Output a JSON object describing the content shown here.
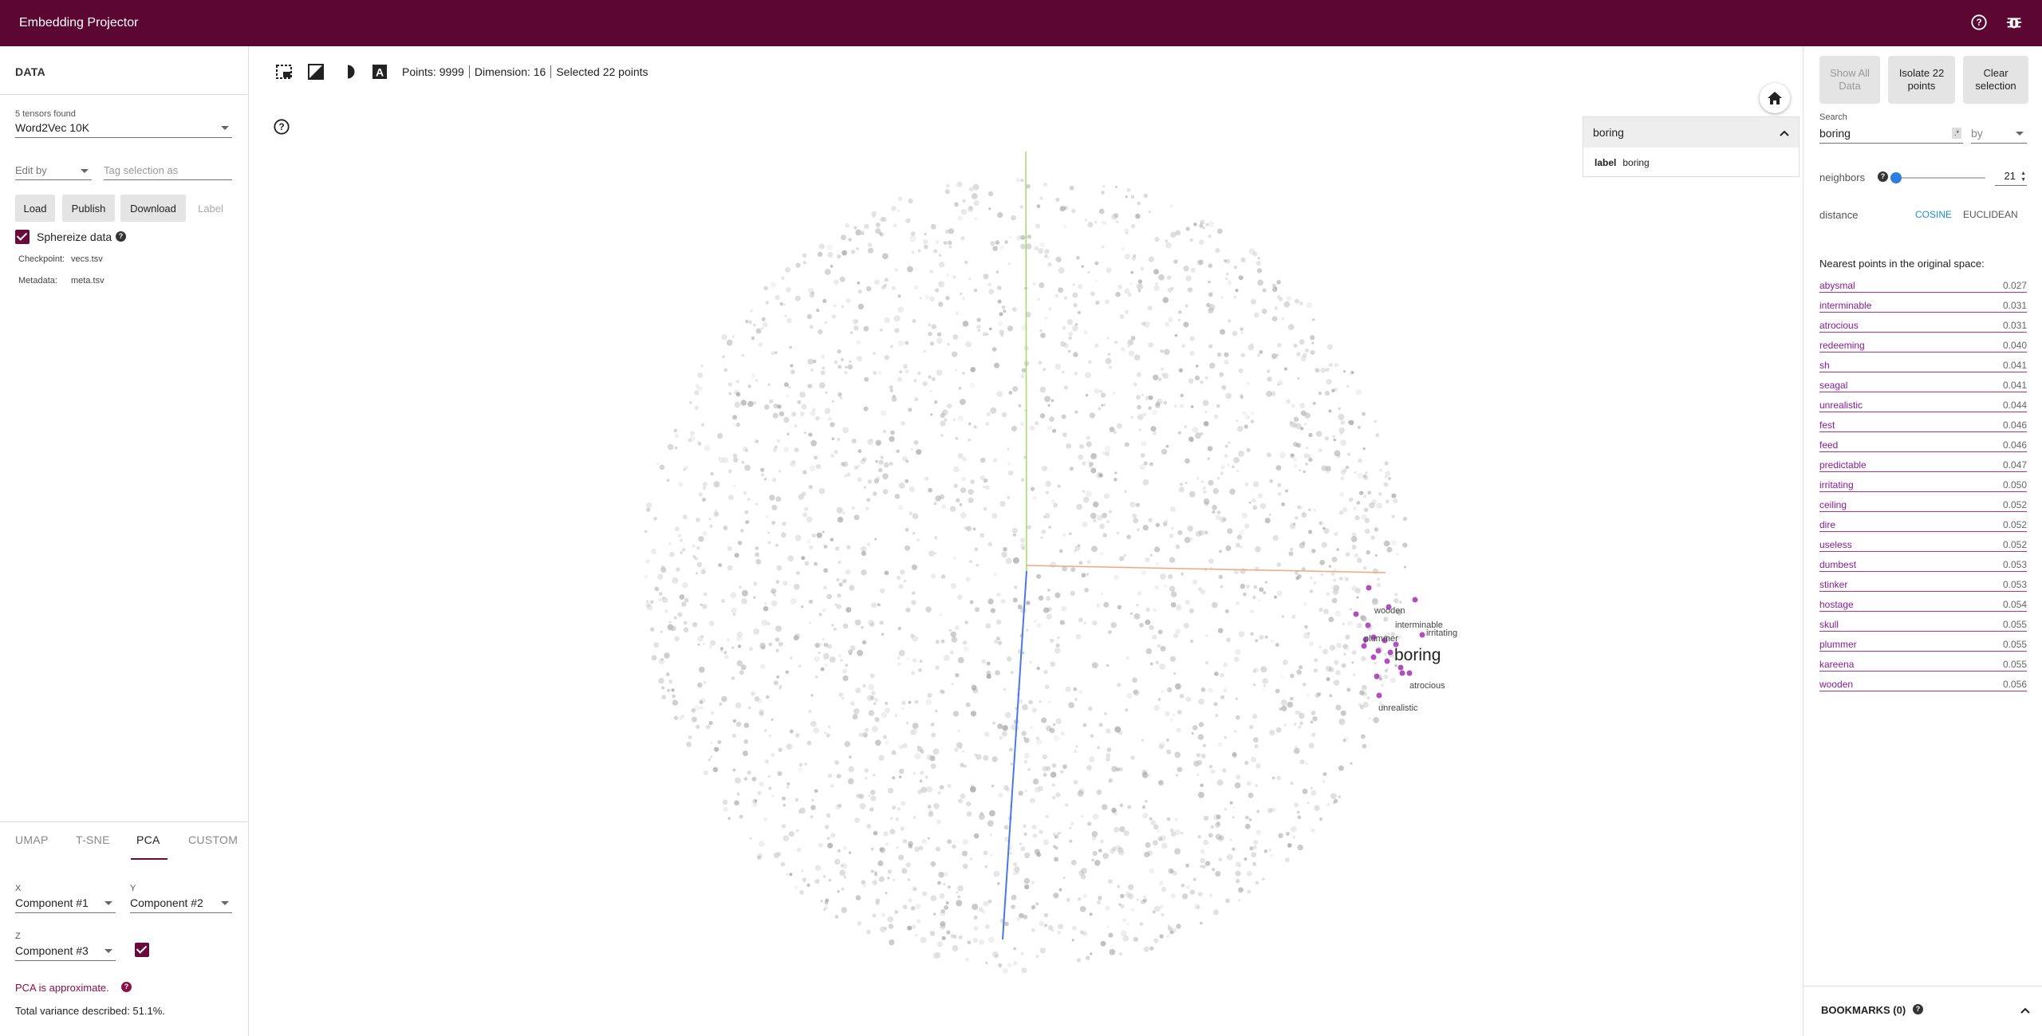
{
  "app": {
    "title": "Embedding Projector"
  },
  "left_panel": {
    "header": "DATA",
    "tensors_found": "5 tensors found",
    "tensor_selected": "Word2Vec 10K",
    "edit_by": "Edit by",
    "tag_placeholder": "Tag selection as",
    "buttons": {
      "load": "Load",
      "publish": "Publish",
      "download": "Download",
      "label": "Label"
    },
    "sphereize": "Sphereize data",
    "checkpoint_label": "Checkpoint:",
    "checkpoint_value": "vecs.tsv",
    "metadata_label": "Metadata:",
    "metadata_value": "meta.tsv",
    "tabs": [
      "UMAP",
      "T-SNE",
      "PCA",
      "CUSTOM"
    ],
    "active_tab": "PCA",
    "pca": {
      "x_label": "X",
      "x_value": "Component #1",
      "y_label": "Y",
      "y_value": "Component #2",
      "z_label": "Z",
      "z_value": "Component #3",
      "approx_text": "PCA is approximate.",
      "variance_text": "Total variance described: 51.1%."
    }
  },
  "center": {
    "stats": {
      "points": "Points: 9999",
      "dimension": "Dimension: 16",
      "selected": "Selected 22 points"
    },
    "label_panel": {
      "header": "boring",
      "label_key": "label",
      "label_value": "boring"
    },
    "focus_label": "boring",
    "point_labels": [
      "wooden",
      "interminable",
      "plummer",
      "irritating",
      "atrocious",
      "unrealistic"
    ],
    "selected_color": "#b04fbd",
    "axis_colors": {
      "x": "#f4a582",
      "y": "#a6d96a",
      "z": "#4a78e8"
    }
  },
  "right_panel": {
    "buttons": {
      "show_all": "Show All Data",
      "isolate": "Isolate 22 points",
      "clear": "Clear selection"
    },
    "search_label": "Search",
    "search_value": "boring",
    "search_by": "by",
    "neighbors_label": "neighbors",
    "neighbors_value": "21",
    "neighbors_slider_fraction": 0.0,
    "distance_label": "distance",
    "distance_cosine": "COSINE",
    "distance_euclidean": "EUCLIDEAN",
    "nn_title": "Nearest points in the original space:",
    "nearest": [
      {
        "word": "abysmal",
        "dist": "0.027"
      },
      {
        "word": "interminable",
        "dist": "0.031"
      },
      {
        "word": "atrocious",
        "dist": "0.031"
      },
      {
        "word": "redeeming",
        "dist": "0.040"
      },
      {
        "word": "sh",
        "dist": "0.041"
      },
      {
        "word": "seagal",
        "dist": "0.041"
      },
      {
        "word": "unrealistic",
        "dist": "0.044"
      },
      {
        "word": "fest",
        "dist": "0.046"
      },
      {
        "word": "feed",
        "dist": "0.046"
      },
      {
        "word": "predictable",
        "dist": "0.047"
      },
      {
        "word": "irritating",
        "dist": "0.050"
      },
      {
        "word": "ceiling",
        "dist": "0.052"
      },
      {
        "word": "dire",
        "dist": "0.052"
      },
      {
        "word": "useless",
        "dist": "0.052"
      },
      {
        "word": "dumbest",
        "dist": "0.053"
      },
      {
        "word": "stinker",
        "dist": "0.053"
      },
      {
        "word": "hostage",
        "dist": "0.054"
      },
      {
        "word": "skull",
        "dist": "0.055"
      },
      {
        "word": "plummer",
        "dist": "0.055"
      },
      {
        "word": "kareena",
        "dist": "0.055"
      },
      {
        "word": "wooden",
        "dist": "0.056"
      }
    ],
    "bookmarks": "BOOKMARKS (0)"
  }
}
